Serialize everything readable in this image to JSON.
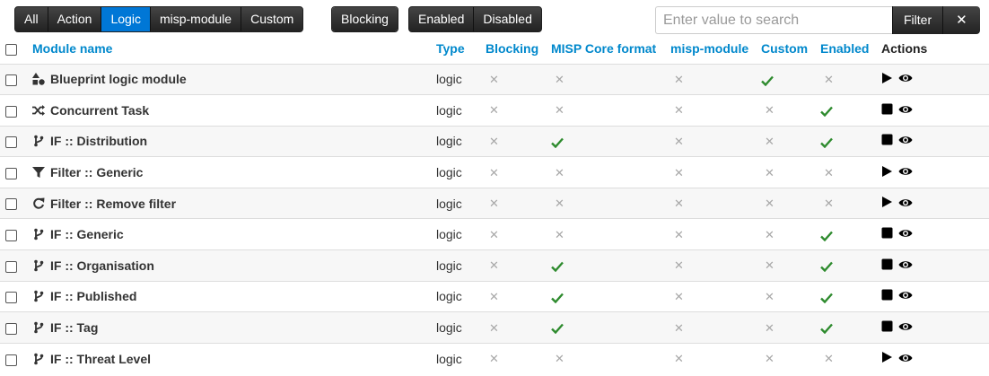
{
  "toolbar": {
    "scope_filters": [
      "All",
      "Action",
      "Logic",
      "misp-module",
      "Custom"
    ],
    "active_scope": "Logic",
    "blocking_label": "Blocking",
    "enabled_filters": [
      "Enabled",
      "Disabled"
    ],
    "search": {
      "placeholder": "Enter value to search",
      "value": "",
      "filter_label": "Filter",
      "clear_label": "✕"
    }
  },
  "table": {
    "headers": {
      "module_name": "Module name",
      "type": "Type",
      "blocking": "Blocking",
      "misp_core": "MISP Core format",
      "misp_module": "misp-module",
      "custom": "Custom",
      "enabled": "Enabled",
      "actions": "Actions"
    },
    "rows": [
      {
        "icon": "shapes-icon",
        "name": "Blueprint logic module",
        "type": "logic",
        "blocking": false,
        "misp_core": false,
        "misp_module": false,
        "custom": true,
        "enabled": false,
        "action": "play"
      },
      {
        "icon": "shuffle-icon",
        "name": "Concurrent Task",
        "type": "logic",
        "blocking": false,
        "misp_core": false,
        "misp_module": false,
        "custom": false,
        "enabled": true,
        "action": "stop"
      },
      {
        "icon": "code-branch-icon",
        "name": "IF :: Distribution",
        "type": "logic",
        "blocking": false,
        "misp_core": true,
        "misp_module": false,
        "custom": false,
        "enabled": true,
        "action": "stop"
      },
      {
        "icon": "filter-icon",
        "name": "Filter :: Generic",
        "type": "logic",
        "blocking": false,
        "misp_core": false,
        "misp_module": false,
        "custom": false,
        "enabled": false,
        "action": "play"
      },
      {
        "icon": "redo-icon",
        "name": "Filter :: Remove filter",
        "type": "logic",
        "blocking": false,
        "misp_core": false,
        "misp_module": false,
        "custom": false,
        "enabled": false,
        "action": "play"
      },
      {
        "icon": "code-branch-icon",
        "name": "IF :: Generic",
        "type": "logic",
        "blocking": false,
        "misp_core": false,
        "misp_module": false,
        "custom": false,
        "enabled": true,
        "action": "stop"
      },
      {
        "icon": "code-branch-icon",
        "name": "IF :: Organisation",
        "type": "logic",
        "blocking": false,
        "misp_core": true,
        "misp_module": false,
        "custom": false,
        "enabled": true,
        "action": "stop"
      },
      {
        "icon": "code-branch-icon",
        "name": "IF :: Published",
        "type": "logic",
        "blocking": false,
        "misp_core": true,
        "misp_module": false,
        "custom": false,
        "enabled": true,
        "action": "stop"
      },
      {
        "icon": "code-branch-icon",
        "name": "IF :: Tag",
        "type": "logic",
        "blocking": false,
        "misp_core": true,
        "misp_module": false,
        "custom": false,
        "enabled": true,
        "action": "stop"
      },
      {
        "icon": "code-branch-icon",
        "name": "IF :: Threat Level",
        "type": "logic",
        "blocking": false,
        "misp_core": false,
        "misp_module": false,
        "custom": false,
        "enabled": false,
        "action": "play"
      }
    ]
  },
  "colors": {
    "accent": "#0088cc",
    "active_button": "#0077d6",
    "check": "#2e8b2e",
    "cross": "#a8a8a8"
  }
}
